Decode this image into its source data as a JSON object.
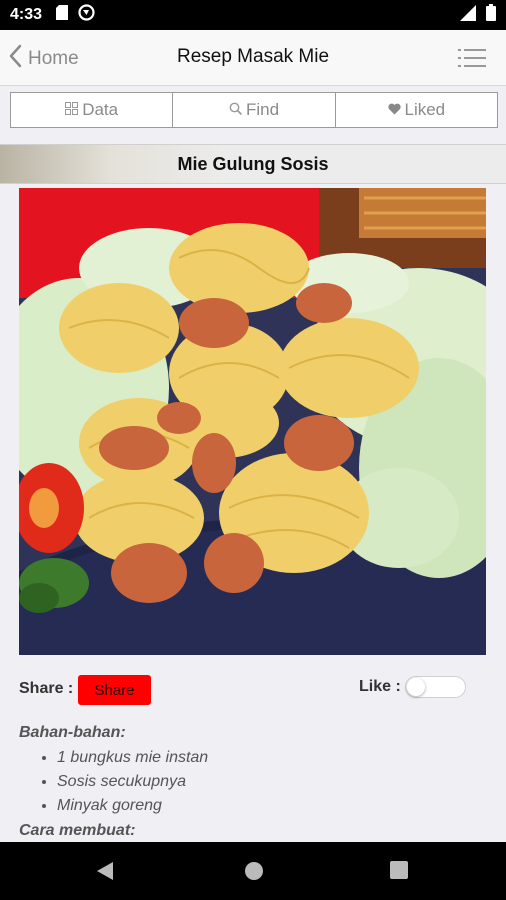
{
  "status_bar": {
    "time": "4:33",
    "icons": [
      "sd-card-icon",
      "sync-icon",
      "signal-icon",
      "battery-icon"
    ]
  },
  "nav": {
    "back_label": "Home",
    "title": "Resep Masak Mie"
  },
  "tabs": [
    {
      "label": "Data",
      "icon": "grid-icon"
    },
    {
      "label": "Find",
      "icon": "search-icon"
    },
    {
      "label": "Liked",
      "icon": "heart-icon"
    }
  ],
  "recipe": {
    "title": "Mie Gulung Sosis",
    "share_label": "Share :",
    "share_button": "Share",
    "like_label": "Like :",
    "like_on": false,
    "ingredients_title": "Bahan-bahan:",
    "ingredients": [
      "1 bungkus mie instan",
      "Sosis secukupnya",
      "Minyak goreng"
    ],
    "method_title": "Cara membuat:"
  },
  "colors": {
    "share_button": "#ff0000",
    "status_bar": "#000000",
    "nav_bg": "#f8f8f8"
  }
}
